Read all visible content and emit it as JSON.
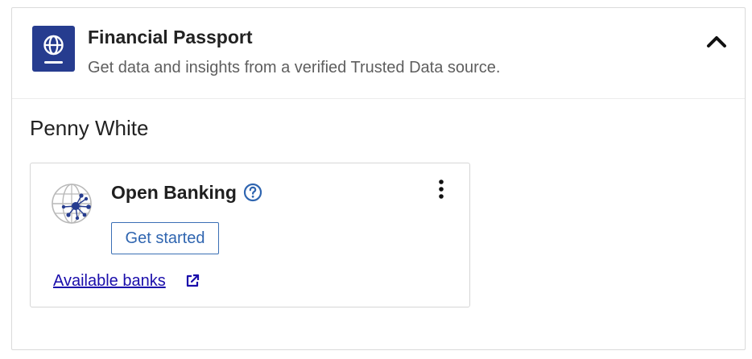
{
  "header": {
    "title": "Financial Passport",
    "subtitle": "Get data and insights from a verified Trusted Data source.",
    "icon": "passport-globe-icon",
    "collapse_icon": "chevron-up-icon"
  },
  "person": {
    "name": "Penny White"
  },
  "card": {
    "title": "Open Banking",
    "icon": "open-banking-globe-icon",
    "help_icon": "question-circle-icon",
    "menu_icon": "kebab-menu-icon",
    "button_label": "Get started",
    "link_label": "Available banks",
    "link_icon": "external-link-icon"
  },
  "colors": {
    "brand_navy": "#263c8f",
    "link_blue": "#1a0dab",
    "button_blue": "#2f65b0",
    "border": "#dadada"
  }
}
